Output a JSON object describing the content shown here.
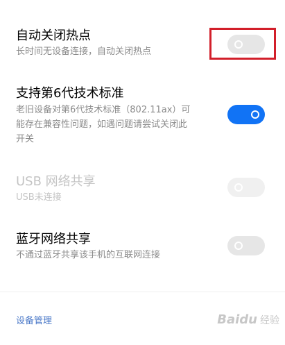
{
  "settings": [
    {
      "title": "自动关闭热点",
      "subtitle": "长时间无设备连接，自动关闭热点",
      "toggle_state": "off",
      "enabled": true,
      "highlighted": true
    },
    {
      "title": "支持第6代技术标准",
      "subtitle_lines": [
        "老旧设备对第6代技术标准（802.11ax）可",
        "能存在兼容性问题，如遇问题请尝试关闭此",
        "开关"
      ],
      "toggle_state": "on",
      "enabled": true
    },
    {
      "title": "USB 网络共享",
      "subtitle": "USB未连接",
      "toggle_state": "off",
      "enabled": false
    },
    {
      "title": "蓝牙网络共享",
      "subtitle": "不通过蓝牙共享该手机的互联网连接",
      "toggle_state": "off",
      "enabled": true
    }
  ],
  "footer": {
    "link_label": "设备管理"
  },
  "watermark": {
    "text": "Baidu",
    "sub": "经验"
  },
  "colors": {
    "toggle_on": "#1173f5",
    "toggle_off": "#e6e6e6",
    "highlight_box": "#d21f2a",
    "link": "#4a78c8"
  }
}
